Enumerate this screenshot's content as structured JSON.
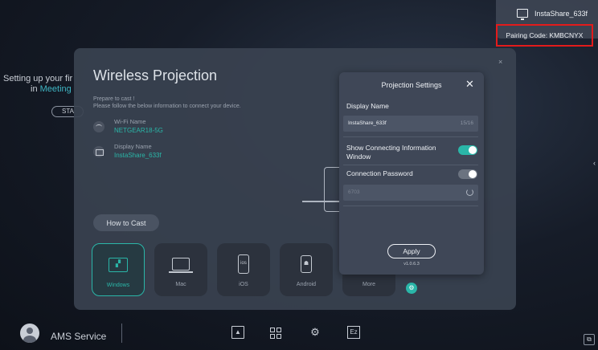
{
  "background": {
    "line1": "Setting up your fir",
    "line2_prefix": "in ",
    "line2_accent": "Meeting",
    "sta_label": "STA"
  },
  "device": {
    "name": "InstaShare_633f",
    "pairing_code": "Pairing Code: KMBCNYX",
    "icon": "monitor-icon"
  },
  "dialog": {
    "title": "Wireless Projection",
    "close": "×",
    "subtitle_line1": "Prepare to cast !",
    "subtitle_line2": "Please follow the below information to connect your device.",
    "wifi_label": "Wi-Fi Name",
    "wifi_value": "NETGEAR18-5G",
    "display_label": "Display Name",
    "display_value": "InstaShare_633f",
    "how_to_cast": "How to Cast",
    "platforms": [
      {
        "name": "Windows",
        "glyph": "▞"
      },
      {
        "name": "Mac",
        "glyph": ""
      },
      {
        "name": "iOS",
        "glyph": "ios"
      },
      {
        "name": "Android",
        "glyph": "☗"
      },
      {
        "name": "More",
        "glyph": "▭"
      }
    ],
    "more_badge": "⚙"
  },
  "projection_settings": {
    "title": "Projection Settings",
    "close": "✕",
    "display_name_label": "Display Name",
    "display_name_value": "InstaShare_633f",
    "display_name_count": "15/16",
    "show_info_label_line1": "Show Connecting Information",
    "show_info_label_line2": "Window",
    "show_info_on": true,
    "password_label": "Connection Password",
    "password_on": false,
    "password_value": "6703",
    "apply": "Apply",
    "version": "v1.0.6.3"
  },
  "taskbar": {
    "user": "AMS Service",
    "cast_icon": "▲",
    "settings_icon": "⚙",
    "ez_icon": "Ez",
    "corner_icon": "⧉",
    "edge_arrow": "‹"
  },
  "colors": {
    "accent": "#2ab6a8",
    "highlight": "#e31b1b"
  }
}
